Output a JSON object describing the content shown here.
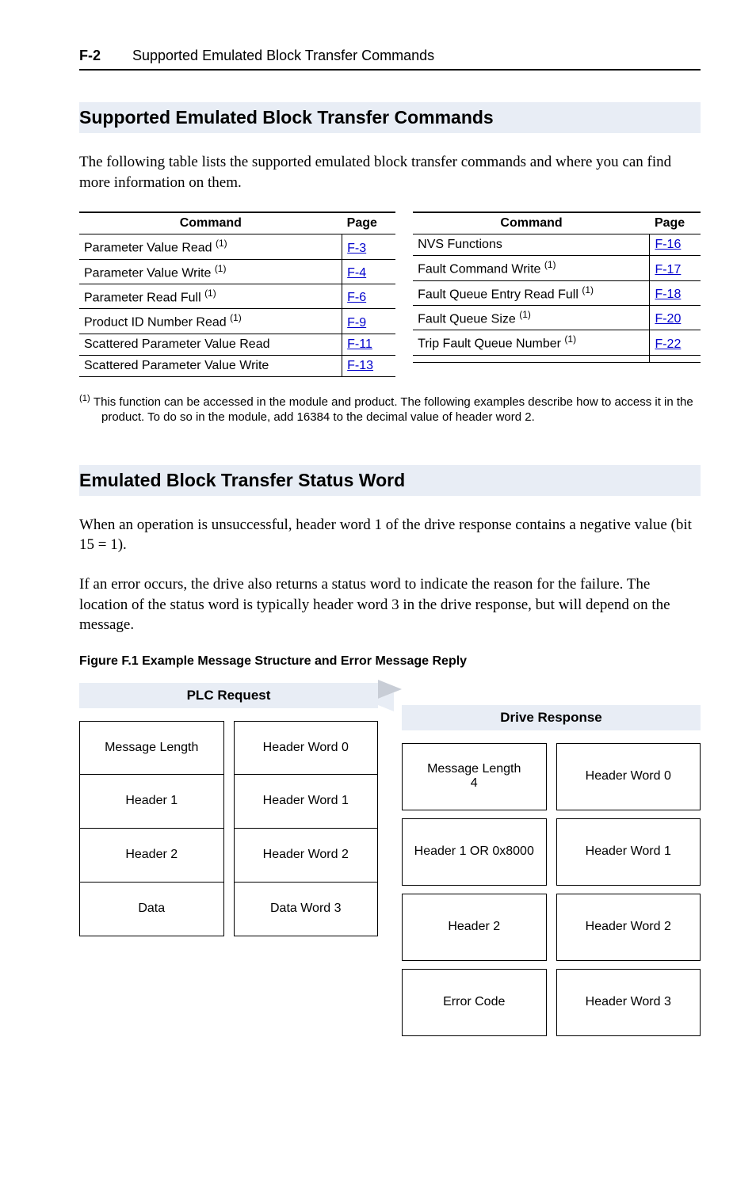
{
  "header": {
    "page_num": "F-2",
    "title": "Supported Emulated Block Transfer Commands"
  },
  "section1": {
    "heading": "Supported Emulated Block Transfer Commands",
    "intro": "The following table lists the supported emulated block transfer commands and where you can find more information on them.",
    "table_headers": {
      "command": "Command",
      "page": "Page"
    },
    "left_rows": [
      {
        "cmd": "Parameter Value Read ",
        "sup": "(1)",
        "page": "F-3"
      },
      {
        "cmd": "Parameter Value Write ",
        "sup": "(1)",
        "page": "F-4"
      },
      {
        "cmd": "Parameter Read Full ",
        "sup": "(1)",
        "page": "F-6"
      },
      {
        "cmd": "Product ID Number Read ",
        "sup": "(1)",
        "page": "F-9"
      },
      {
        "cmd": "Scattered Parameter Value Read",
        "sup": "",
        "page": "F-11"
      },
      {
        "cmd": "Scattered Parameter Value Write",
        "sup": "",
        "page": "F-13"
      }
    ],
    "right_rows": [
      {
        "cmd": "NVS Functions",
        "sup": "",
        "page": "F-16"
      },
      {
        "cmd": "Fault Command Write ",
        "sup": "(1)",
        "page": "F-17"
      },
      {
        "cmd": "Fault Queue Entry Read Full ",
        "sup": "(1)",
        "page": "F-18"
      },
      {
        "cmd": "Fault Queue Size ",
        "sup": "(1)",
        "page": "F-20"
      },
      {
        "cmd": "Trip Fault Queue Number ",
        "sup": "(1)",
        "page": "F-22"
      },
      {
        "cmd": "",
        "sup": "",
        "page": ""
      }
    ],
    "footnote_marker": "(1)",
    "footnote": "This function can be accessed in the module and product. The following examples describe how to access it in the product. To do so in the module, add 16384 to the decimal value of header word 2."
  },
  "section2": {
    "heading": "Emulated Block Transfer Status Word",
    "para1": "When an operation is unsuccessful, header word 1 of the drive response contains a negative value (bit 15 = 1).",
    "para2": "If an error occurs, the drive also returns a status word to indicate the reason for the failure. The location of the status word is typically header word 3 in the drive response, but will depend on the message.",
    "figure_caption": "Figure F.1   Example Message Structure and Error Message Reply",
    "plc_label": "PLC Request",
    "drive_label": "Drive Response",
    "plc_left": [
      "Message Length",
      "Header 1",
      "Header 2",
      "Data"
    ],
    "plc_right": [
      "Header Word 0",
      "Header Word 1",
      "Header Word 2",
      "Data Word 3"
    ],
    "drive_left": [
      {
        "l1": "Message Length",
        "l2": "4"
      },
      {
        "l1": "Header 1 OR 0x8000",
        "l2": ""
      },
      {
        "l1": "Header 2",
        "l2": ""
      },
      {
        "l1": "Error Code",
        "l2": ""
      }
    ],
    "drive_right": [
      "Header Word 0",
      "Header Word 1",
      "Header Word 2",
      "Header Word 3"
    ]
  }
}
